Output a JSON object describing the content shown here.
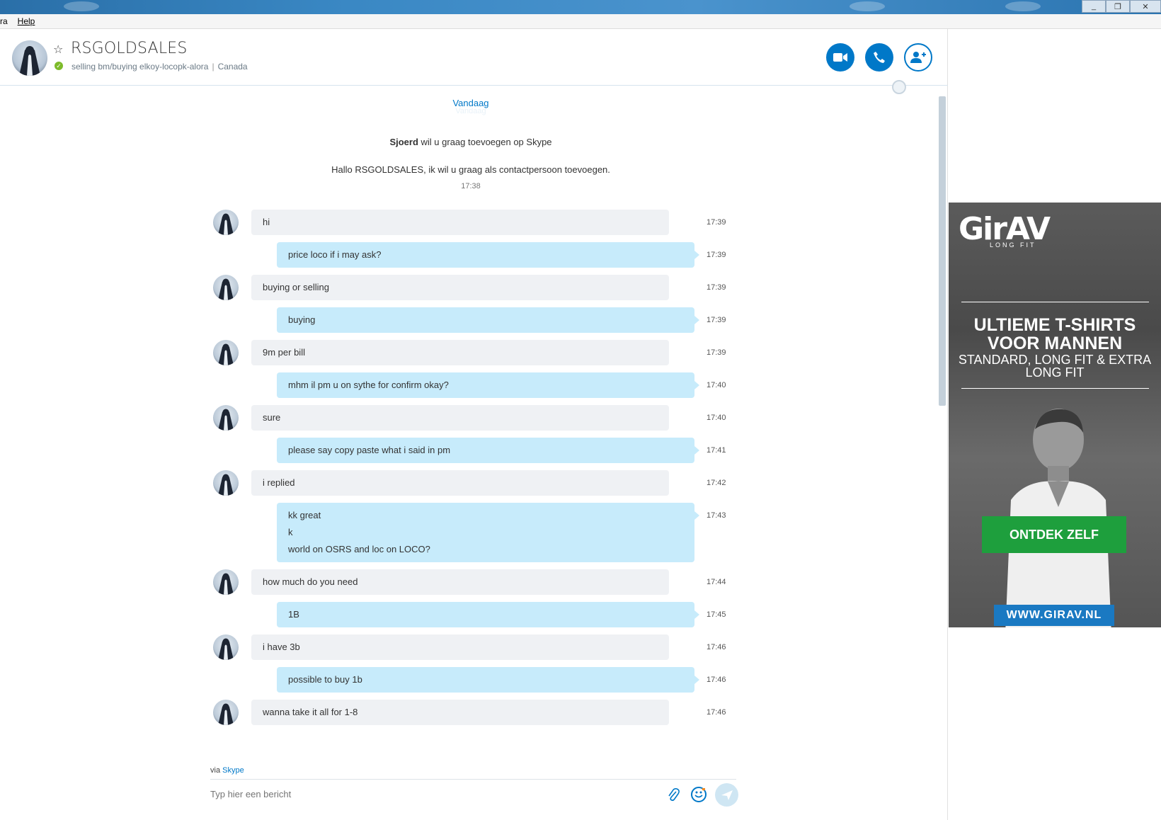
{
  "menu": {
    "item1": "ra",
    "item2": "Help"
  },
  "window": {
    "minimize": "_",
    "restore": "❐",
    "close": "✕"
  },
  "contact": {
    "name": "RSGOLDSALES",
    "mood": "selling bm/buying elkoy-locopk-alora",
    "location": "Canada",
    "status_color": "#7dbb2a"
  },
  "conversation": {
    "day_label": "Vandaag",
    "day_ghost": "Vandaag",
    "system_sender": "Sjoerd",
    "system_text": " wil u graag toevoegen op Skype",
    "request_text": "Hallo RSGOLDSALES, ik wil u graag als contactpersoon toevoegen.",
    "request_time": "17:38"
  },
  "messages": [
    {
      "dir": "in",
      "lines": [
        "hi"
      ],
      "time": "17:39"
    },
    {
      "dir": "out",
      "lines": [
        "price loco if i may ask?"
      ],
      "time": "17:39"
    },
    {
      "dir": "in",
      "lines": [
        "buying or selling"
      ],
      "time": "17:39"
    },
    {
      "dir": "out",
      "lines": [
        "buying"
      ],
      "time": "17:39"
    },
    {
      "dir": "in",
      "lines": [
        "9m per bill"
      ],
      "time": "17:39"
    },
    {
      "dir": "out",
      "lines": [
        "mhm il pm u on sythe for confirm okay?"
      ],
      "time": "17:40"
    },
    {
      "dir": "in",
      "lines": [
        "sure"
      ],
      "time": "17:40"
    },
    {
      "dir": "out",
      "lines": [
        "please say copy paste what i said in pm"
      ],
      "time": "17:41"
    },
    {
      "dir": "in",
      "lines": [
        "i replied"
      ],
      "time": "17:42"
    },
    {
      "dir": "out",
      "lines": [
        "kk great",
        "k",
        "world on OSRS and loc on LOCO?"
      ],
      "time": "17:43"
    },
    {
      "dir": "in",
      "lines": [
        "how much do you need"
      ],
      "time": "17:44"
    },
    {
      "dir": "out",
      "lines": [
        "1B"
      ],
      "time": "17:45"
    },
    {
      "dir": "in",
      "lines": [
        "i have 3b"
      ],
      "time": "17:46"
    },
    {
      "dir": "out",
      "lines": [
        "possible to buy 1b"
      ],
      "time": "17:46"
    },
    {
      "dir": "in",
      "lines": [
        "wanna take it all for 1-8"
      ],
      "time": "17:46"
    }
  ],
  "compose": {
    "via_prefix": "via ",
    "via_link": "Skype",
    "placeholder": "Typ hier een bericht"
  },
  "ad": {
    "logo": "GirAV",
    "logo_sub": "LONG FIT",
    "headline": "ULTIEME T-SHIRTS VOOR MANNEN",
    "subline": "STANDARD, LONG FIT & EXTRA LONG FIT",
    "cta": "ONTDEK ZELF",
    "url": "WWW.GIRAV.NL"
  }
}
